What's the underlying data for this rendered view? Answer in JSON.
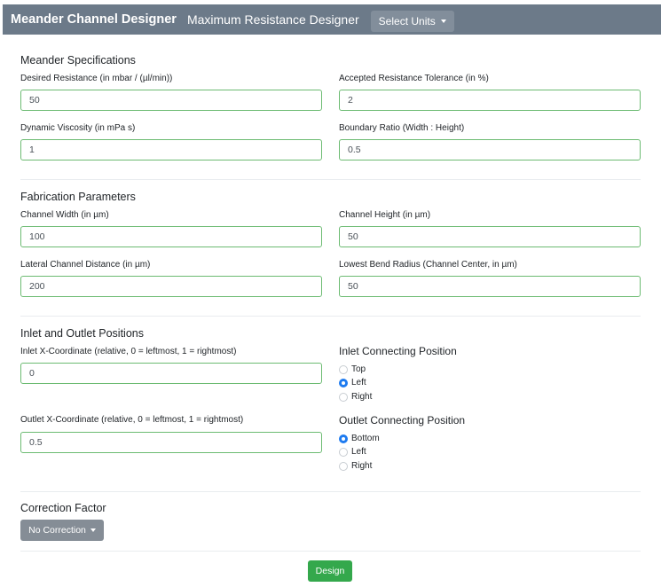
{
  "navbar": {
    "brand": "Meander Channel Designer",
    "link": "Maximum Resistance Designer",
    "units_button": "Select Units"
  },
  "meander": {
    "title": "Meander Specifications",
    "desired_resistance": {
      "label": "Desired Resistance (in mbar / (µl/min))",
      "value": "50"
    },
    "tolerance": {
      "label": "Accepted Resistance Tolerance (in %)",
      "value": "2"
    },
    "viscosity": {
      "label": "Dynamic Viscosity (in mPa s)",
      "value": "1"
    },
    "boundary_ratio": {
      "label": "Boundary Ratio (Width : Height)",
      "value": "0.5"
    }
  },
  "fabrication": {
    "title": "Fabrication Parameters",
    "channel_width": {
      "label": "Channel Width (in µm)",
      "value": "100"
    },
    "channel_height": {
      "label": "Channel Height (in µm)",
      "value": "50"
    },
    "lateral_distance": {
      "label": "Lateral Channel Distance (in µm)",
      "value": "200"
    },
    "bend_radius": {
      "label": "Lowest Bend Radius (Channel Center, in µm)",
      "value": "50"
    }
  },
  "positions": {
    "title": "Inlet and Outlet Positions",
    "inlet_x": {
      "label": "Inlet X-Coordinate (relative, 0 = leftmost, 1 = rightmost)",
      "value": "0"
    },
    "outlet_x": {
      "label": "Outlet X-Coordinate (relative, 0 = leftmost, 1 = rightmost)",
      "value": "0.5"
    },
    "inlet_connecting": {
      "title": "Inlet Connecting Position",
      "options": [
        "Top",
        "Left",
        "Right"
      ],
      "selected": "Left"
    },
    "outlet_connecting": {
      "title": "Outlet Connecting Position",
      "options": [
        "Bottom",
        "Left",
        "Right"
      ],
      "selected": "Bottom"
    }
  },
  "correction": {
    "title": "Correction Factor",
    "button": "No Correction"
  },
  "design_button": "Design",
  "colors": {
    "navbar": "#6c7a89",
    "valid_border": "#6cbb72",
    "radio_checked": "#1e7bf0",
    "design_button": "#34a84c",
    "secondary_button": "#858d96"
  }
}
